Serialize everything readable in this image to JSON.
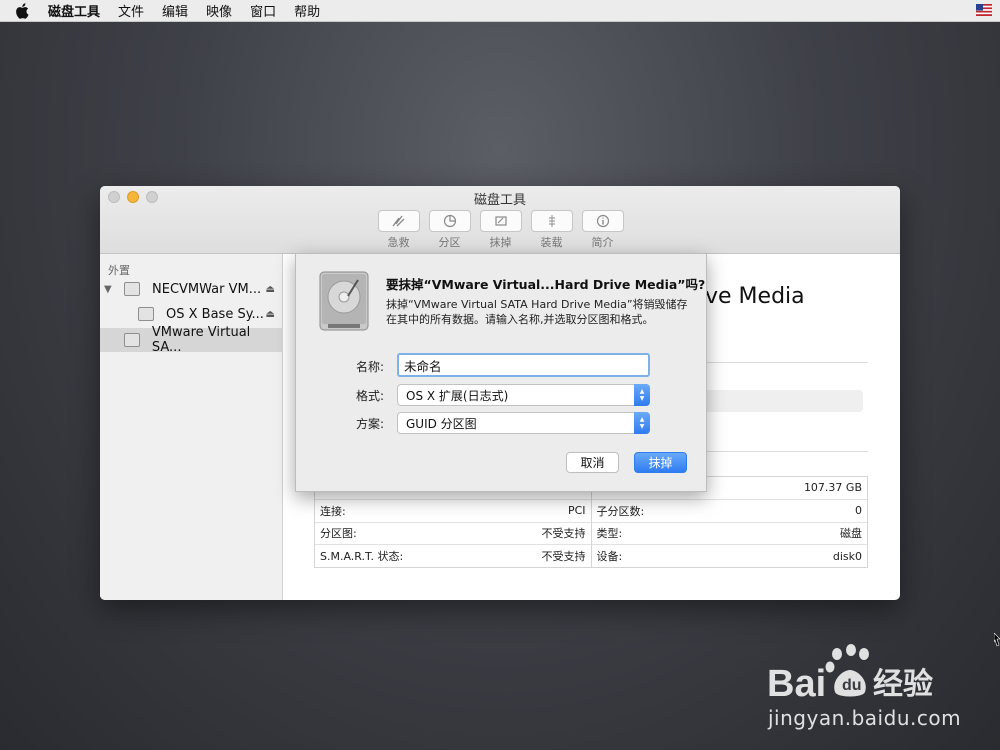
{
  "menubar": {
    "app_name": "磁盘工具",
    "items": [
      "文件",
      "编辑",
      "映像",
      "窗口",
      "帮助"
    ]
  },
  "window": {
    "title": "磁盘工具",
    "toolbar": [
      {
        "label": "急救",
        "icon": "first-aid-icon"
      },
      {
        "label": "分区",
        "icon": "partition-icon"
      },
      {
        "label": "抹掉",
        "icon": "erase-icon"
      },
      {
        "label": "装载",
        "icon": "mount-icon"
      },
      {
        "label": "简介",
        "icon": "info-icon"
      }
    ]
  },
  "sidebar": {
    "header": "外置",
    "items": [
      {
        "label": "NECVMWar VM..."
      },
      {
        "label": "OS X Base Sy..."
      },
      {
        "label": "VMware Virtual SA..."
      }
    ]
  },
  "main": {
    "disk_title_partial": "ve Media",
    "info_left": [
      {
        "label": "",
        "value": ""
      },
      {
        "label": "连接:",
        "value": "PCI"
      },
      {
        "label": "分区图:",
        "value": "不受支持"
      },
      {
        "label": "S.M.A.R.T. 状态:",
        "value": "不受支持"
      }
    ],
    "info_right": [
      {
        "label": "",
        "value": "107.37 GB"
      },
      {
        "label": "子分区数:",
        "value": "0"
      },
      {
        "label": "类型:",
        "value": "磁盘"
      },
      {
        "label": "设备:",
        "value": "disk0"
      }
    ]
  },
  "sheet": {
    "title": "要抹掉“VMware Virtual...Hard Drive Media”吗?",
    "description": "抹掉“VMware Virtual SATA Hard Drive Media”将销毁储存在其中的所有数据。请输入名称,并选取分区图和格式。",
    "name_label": "名称:",
    "name_value": "未命名",
    "format_label": "格式:",
    "format_value": "OS X 扩展(日志式)",
    "scheme_label": "方案:",
    "scheme_value": "GUID 分区图",
    "cancel_label": "取消",
    "erase_label": "抹掉"
  },
  "watermark": {
    "subtext": "jingyan.baidu.com"
  },
  "colors": {
    "accent": "#2f7cf0",
    "minimize": "#f5b53a"
  }
}
